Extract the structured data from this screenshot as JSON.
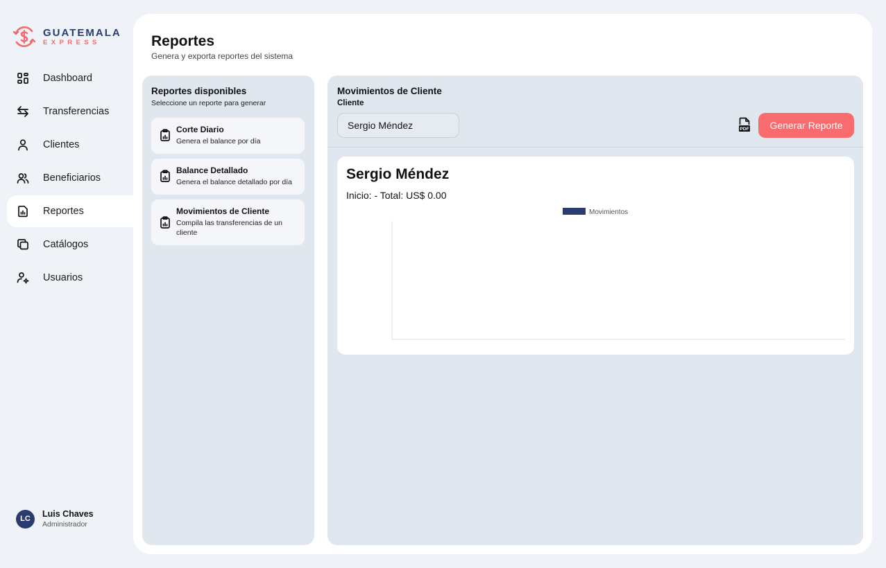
{
  "brand": {
    "name": "GUATEMALA",
    "tagline": "EXPRESS"
  },
  "nav": {
    "items": [
      {
        "label": "Dashboard",
        "icon": "dashboard-icon"
      },
      {
        "label": "Transferencias",
        "icon": "transfer-arrows-icon"
      },
      {
        "label": "Clientes",
        "icon": "user-icon"
      },
      {
        "label": "Beneficiarios",
        "icon": "users-icon"
      },
      {
        "label": "Reportes",
        "icon": "report-file-icon",
        "active": true
      },
      {
        "label": "Catálogos",
        "icon": "copy-icon"
      },
      {
        "label": "Usuarios",
        "icon": "user-settings-icon"
      }
    ]
  },
  "user": {
    "initials": "LC",
    "name": "Luis Chaves",
    "role": "Administrador"
  },
  "page": {
    "title": "Reportes",
    "subtitle": "Genera y exporta reportes del sistema"
  },
  "reports_panel": {
    "title": "Reportes disponibles",
    "subtitle": "Seleccione un reporte para generar",
    "items": [
      {
        "title": "Corte Diario",
        "description": "Genera el balance por día"
      },
      {
        "title": "Balance Detallado",
        "description": "Genera el balance detallado por día"
      },
      {
        "title": "Movimientos de Cliente",
        "description": "Compila las transferencias de un cliente"
      }
    ]
  },
  "detail": {
    "title": "Movimientos de Cliente",
    "client_label": "Cliente",
    "client_value": "Sergio Méndez",
    "generate_label": "Generar Reporte",
    "pdf_icon": "pdf-file-icon"
  },
  "result": {
    "client_name": "Sergio Méndez",
    "summary": "Inicio: - Total: US$ 0.00"
  },
  "chart_data": {
    "type": "bar",
    "categories": [],
    "series": [
      {
        "name": "Movimientos",
        "values": []
      }
    ],
    "colors": {
      "series": "#2a3b6e",
      "axis": "#dde1e7"
    }
  },
  "colors": {
    "accent": "#f86b6e",
    "brand_navy": "#2a3b6e",
    "panel": "#e1e7ef"
  }
}
